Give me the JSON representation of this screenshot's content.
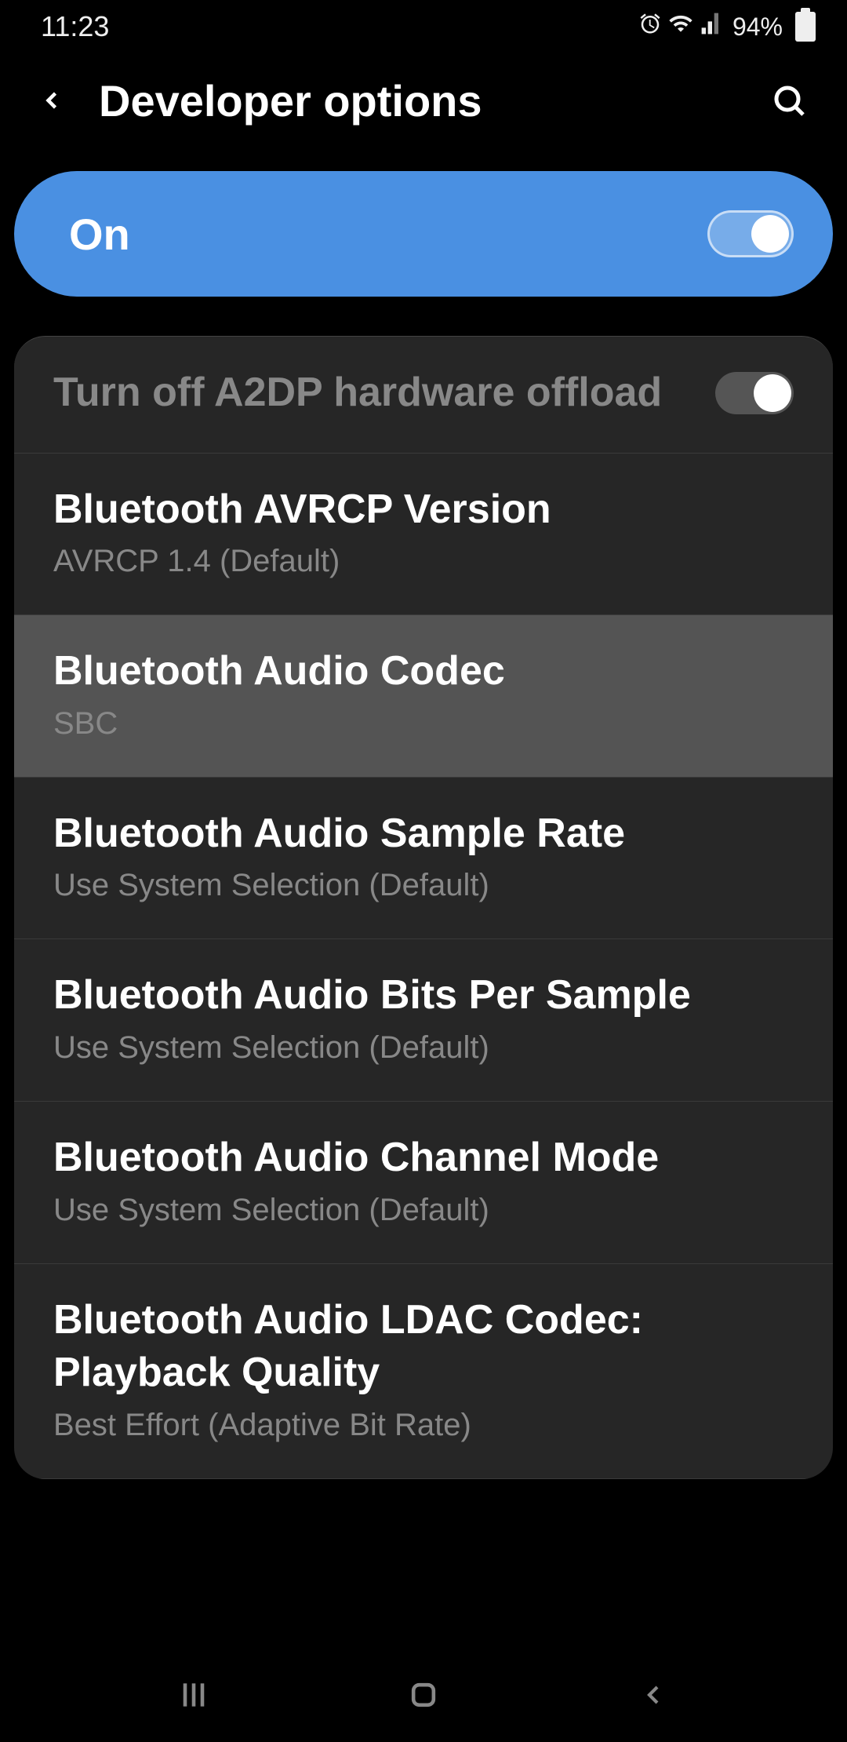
{
  "status": {
    "time": "11:23",
    "battery": "94%"
  },
  "header": {
    "title": "Developer options"
  },
  "master": {
    "label": "On",
    "enabled": true
  },
  "items": [
    {
      "title": "Turn off A2DP hardware offload",
      "sub": null,
      "toggle": true,
      "dim": true,
      "highlighted": false
    },
    {
      "title": "Bluetooth AVRCP Version",
      "sub": "AVRCP 1.4 (Default)",
      "toggle": false,
      "dim": false,
      "highlighted": false
    },
    {
      "title": "Bluetooth Audio Codec",
      "sub": "SBC",
      "toggle": false,
      "dim": false,
      "highlighted": true
    },
    {
      "title": "Bluetooth Audio Sample Rate",
      "sub": "Use System Selection (Default)",
      "toggle": false,
      "dim": false,
      "highlighted": false
    },
    {
      "title": "Bluetooth Audio Bits Per Sample",
      "sub": "Use System Selection (Default)",
      "toggle": false,
      "dim": false,
      "highlighted": false
    },
    {
      "title": "Bluetooth Audio Channel Mode",
      "sub": "Use System Selection (Default)",
      "toggle": false,
      "dim": false,
      "highlighted": false
    },
    {
      "title": "Bluetooth Audio LDAC Codec: Playback Quality",
      "sub": "Best Effort (Adaptive Bit Rate)",
      "toggle": false,
      "dim": false,
      "highlighted": false
    }
  ]
}
